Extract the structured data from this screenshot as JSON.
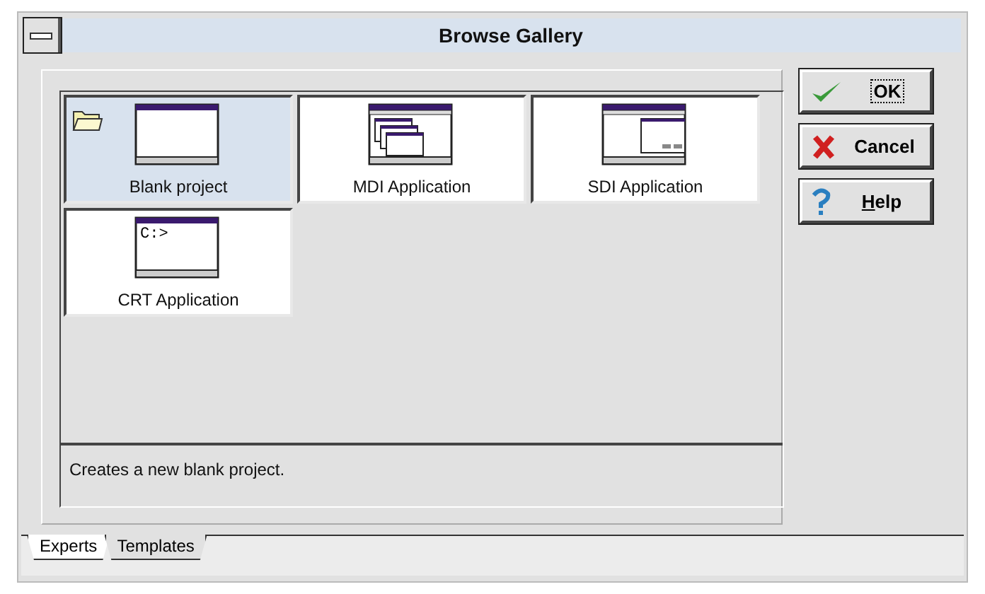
{
  "window": {
    "title": "Browse Gallery"
  },
  "gallery": {
    "items": [
      {
        "label": "Blank project",
        "kind": "blank",
        "selected": true
      },
      {
        "label": "MDI Application",
        "kind": "mdi",
        "selected": false
      },
      {
        "label": "SDI Application",
        "kind": "sdi",
        "selected": false
      },
      {
        "label": "CRT Application",
        "kind": "crt",
        "selected": false,
        "prompt": "C:>"
      }
    ]
  },
  "description": "Creates a new blank project.",
  "buttons": [
    {
      "label": "OK",
      "kind": "ok"
    },
    {
      "label": "Cancel",
      "kind": "cancel"
    },
    {
      "label": "Help",
      "kind": "help",
      "underline_first": true
    }
  ],
  "tabs": [
    {
      "label": "Experts",
      "selected": false
    },
    {
      "label": "Templates",
      "selected": true
    }
  ]
}
